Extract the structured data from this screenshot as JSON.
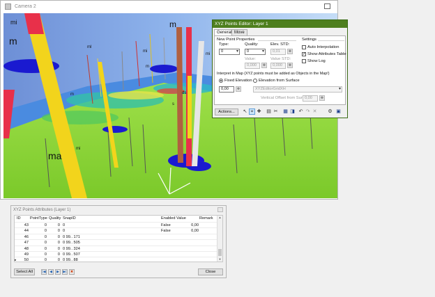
{
  "camera": {
    "title": "Camera 2"
  },
  "viewport_labels": [
    "mi",
    "m",
    "ml",
    "mi",
    "m",
    "m",
    "mi",
    "ds",
    "s",
    "m",
    "ma",
    "mi"
  ],
  "xyz": {
    "title": "XYZ Points Editor: Layer 1",
    "tabs": [
      "General",
      "Move"
    ],
    "new_point": {
      "group_label": "New Point Properties",
      "type_label": "Type:",
      "type_value": "0",
      "quality_label": "Quality:",
      "quality_value": "0",
      "elev_label": "Elev. STD:",
      "elev_value": "0,01",
      "value_label": "Value:",
      "value_value": "0,000",
      "value_std_label": "Value STD:",
      "value_std_value": "0,000"
    },
    "settings": {
      "group_label": "Settings",
      "auto_interp": "Auto Interpolation",
      "show_table": "Show Attributes Table",
      "show_log": "Show Log",
      "auto_interp_checked": false,
      "show_table_checked": true,
      "show_log_checked": false
    },
    "interpret": {
      "label": "Interpret in Map (XYZ points must be added as Objects in the Map!)",
      "fixed_label": "Fixed Elevation",
      "surface_label": "Elevation from Surface",
      "fixed_value": "0,00",
      "surface_select": "XYZEditorGridXH",
      "offset_label": "Vertical Offset from Surface",
      "offset_value": "0,00"
    },
    "actions_label": "Actions...",
    "toolbar_icons": [
      "pointer-icon",
      "select-point-icon",
      "add-point-icon",
      "copy-icon",
      "delete-icon",
      "table-icon",
      "color-icon",
      "undo-icon",
      "redo-icon",
      "cut-icon",
      "properties-icon",
      "save-icon"
    ]
  },
  "attributes": {
    "title": "XYZ Points Attributes (Layer 1)",
    "columns": [
      "ID",
      "PointType",
      "Quality",
      "SnapID",
      "Enabled",
      "Value",
      "Remark"
    ],
    "rows": [
      {
        "id": "43",
        "type": "0",
        "quality": "0",
        "snap": "0",
        "enabled": "False",
        "value": "0,00",
        "remark": ""
      },
      {
        "id": "44",
        "type": "0",
        "quality": "0",
        "snap": "0",
        "enabled": "False",
        "value": "0,00",
        "remark": ""
      },
      {
        "id": "46",
        "type": "0",
        "quality": "0",
        "snap": "0 99.. 171",
        "enabled": "",
        "value": "",
        "remark": ""
      },
      {
        "id": "47",
        "type": "0",
        "quality": "0",
        "snap": "0 99.. 505",
        "enabled": "",
        "value": "",
        "remark": ""
      },
      {
        "id": "48",
        "type": "0",
        "quality": "0",
        "snap": "0 99.. 324",
        "enabled": "",
        "value": "",
        "remark": ""
      },
      {
        "id": "49",
        "type": "0",
        "quality": "0",
        "snap": "0 99.. 507",
        "enabled": "",
        "value": "",
        "remark": ""
      },
      {
        "id": "50",
        "type": "0",
        "quality": "0",
        "snap": "0 99.. 88",
        "enabled": "",
        "value": "",
        "remark": ""
      }
    ],
    "select_all_label": "Select All",
    "close_label": "Close",
    "nav_icons": [
      "first-record-icon",
      "previous-record-icon",
      "next-record-icon",
      "last-record-icon",
      "delete-record-icon"
    ]
  }
}
